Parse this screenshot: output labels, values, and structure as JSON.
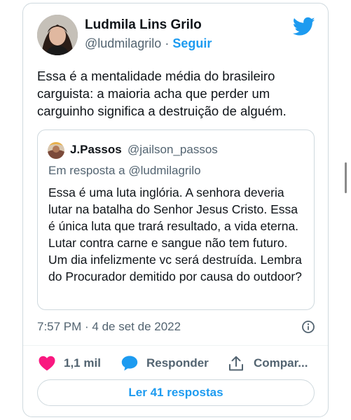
{
  "tweet": {
    "author": {
      "name": "Ludmila Lins Grilo",
      "handle": "@ludmilagrilo",
      "separator": "·",
      "follow_label": "Seguir"
    },
    "text": "Essa é a mentalidade média do brasileiro carguista: a maioria acha que perder um carguinho significa a destruição de alguém.",
    "quoted": {
      "name": "J.Passos",
      "handle": "@jailson_passos",
      "reply_to": "Em resposta a @ludmilagrilo",
      "text": "Essa é uma luta inglória. A senhora deveria lutar na batalha do Senhor Jesus Cristo. Essa é única luta que trará resultado, a vida eterna. Lutar contra carne e sangue não tem futuro. Um dia infelizmente vc será destruída. Lembra do Procurador demitido por causa do outdoor?"
    },
    "timestamp": "7:57 PM · 4 de set de 2022",
    "actions": {
      "likes": "1,1 mil",
      "reply_label": "Responder",
      "share_label": "Compar..."
    },
    "read_replies_label": "Ler 41 respostas"
  },
  "icons": {
    "brand": "twitter-bird-icon",
    "like": "heart-icon",
    "reply": "speech-bubble-icon",
    "share": "share-upload-icon",
    "info": "info-icon"
  },
  "colors": {
    "brand_blue": "#1d9bf0",
    "like_pink": "#f91880",
    "text_primary": "#0f1419",
    "text_secondary": "#536471",
    "border": "#cfd9de"
  }
}
